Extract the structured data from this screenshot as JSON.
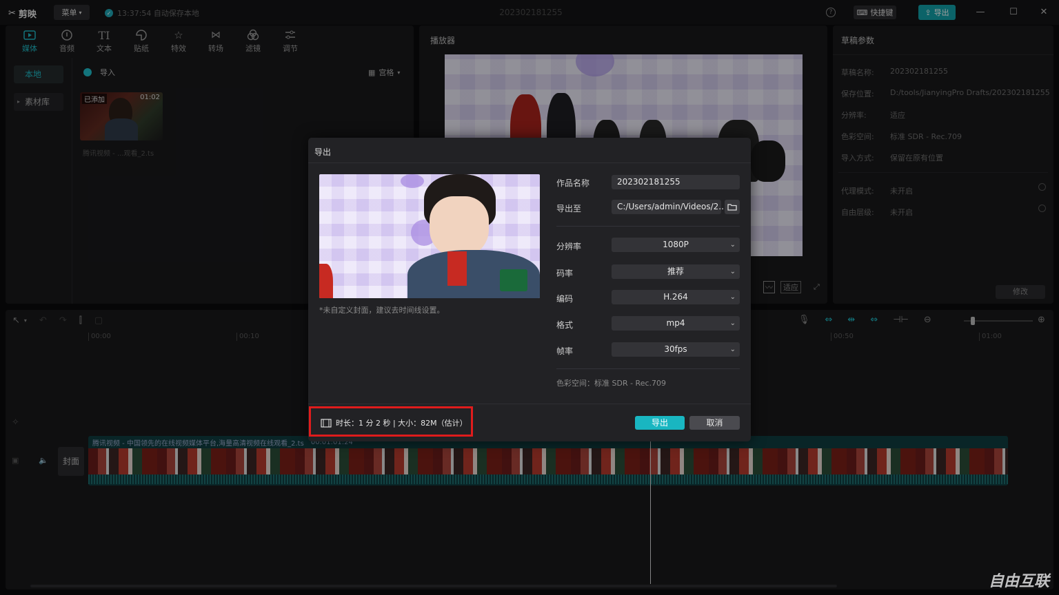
{
  "titlebar": {
    "logo": "剪映",
    "menu": "菜单",
    "autosave": "13:37:54 自动保存本地",
    "doc_title": "202302181255",
    "help": "?",
    "shortcut": "快捷键",
    "export": "导出"
  },
  "media": {
    "tools": [
      {
        "label": "媒体",
        "icon": "media-icon"
      },
      {
        "label": "音频",
        "icon": "audio-icon"
      },
      {
        "label": "文本",
        "icon": "text-icon"
      },
      {
        "label": "贴纸",
        "icon": "sticker-icon"
      },
      {
        "label": "特效",
        "icon": "effects-icon"
      },
      {
        "label": "转场",
        "icon": "transition-icon"
      },
      {
        "label": "滤镜",
        "icon": "filter-icon"
      },
      {
        "label": "调节",
        "icon": "adjust-icon"
      }
    ],
    "side": [
      "本地",
      "素材库"
    ],
    "import": "导入",
    "view": "宫格",
    "thumb_badge": "已添加",
    "thumb_duration": "01:02",
    "thumb_name": "腾讯视频 - ...观看_2.ts"
  },
  "player": {
    "title": "播放器",
    "fit": "适应"
  },
  "props": {
    "title": "草稿参数",
    "rows": [
      {
        "label": "草稿名称:",
        "value": "202302181255"
      },
      {
        "label": "保存位置:",
        "value": "D:/tools/JianyingPro Drafts/202302181255"
      },
      {
        "label": "分辨率:",
        "value": "适应"
      },
      {
        "label": "色彩空间:",
        "value": "标准 SDR - Rec.709"
      },
      {
        "label": "导入方式:",
        "value": "保留在原有位置"
      },
      {
        "label": "代理模式:",
        "value": "未开启"
      },
      {
        "label": "自由层级:",
        "value": "未开启"
      }
    ],
    "modify": "修改"
  },
  "timeline": {
    "ticks": [
      "00:00",
      "00:10",
      "00:50",
      "01:00"
    ],
    "cover": "封面",
    "clip_name": "腾讯视频 - 中国领先的在线视频媒体平台,海量高清视频在线观看_2.ts",
    "clip_time": "00:01:01:24"
  },
  "dialog": {
    "title": "导出",
    "cover_hint": "*未自定义封面，建议去时间线设置。",
    "name_label": "作品名称",
    "name_value": "202302181255",
    "path_label": "导出至",
    "path_value": "C:/Users/admin/Videos/2...",
    "resolution_label": "分辨率",
    "resolution_value": "1080P",
    "bitrate_label": "码率",
    "bitrate_value": "推荐",
    "codec_label": "编码",
    "codec_value": "H.264",
    "format_label": "格式",
    "format_value": "mp4",
    "fps_label": "帧率",
    "fps_value": "30fps",
    "colorspace": "色彩空间：标准 SDR - Rec.709",
    "summary": "时长：1 分 2 秒 | 大小：82M（估计）",
    "export_btn": "导出",
    "cancel_btn": "取消"
  },
  "watermark": "自由互联"
}
